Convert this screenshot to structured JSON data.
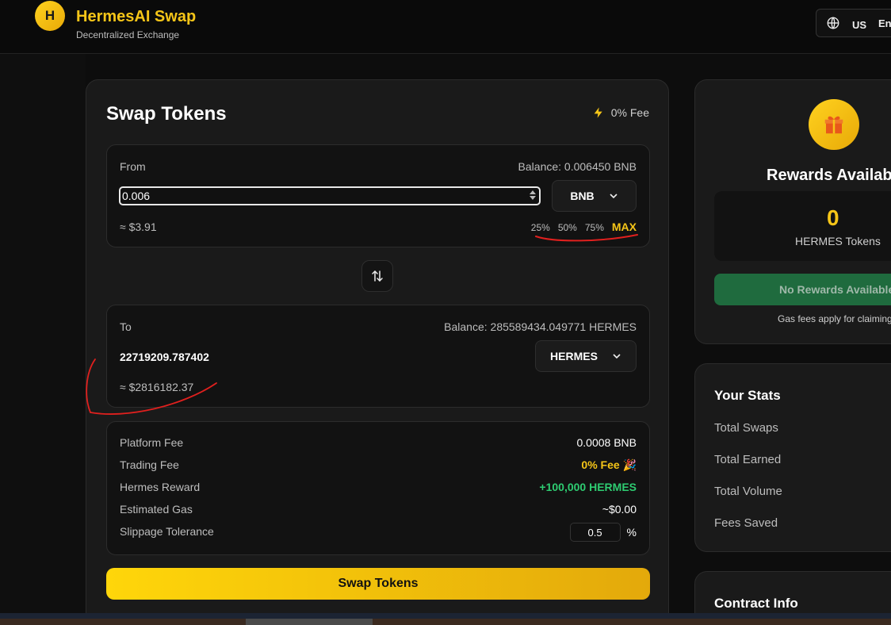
{
  "header": {
    "logo_letter": "H",
    "title": "HermesAI Swap",
    "subtitle": "Decentralized Exchange",
    "region": "US",
    "language": "Eng"
  },
  "swap": {
    "title": "Swap Tokens",
    "fee_tag": "0% Fee",
    "from": {
      "label": "From",
      "balance": "Balance: 0.006450 BNB",
      "amount": "0.006",
      "token": "BNB",
      "usd_estimate": "≈ $3.91",
      "percent_buttons": [
        "25%",
        "50%",
        "75%"
      ],
      "max_label": "MAX"
    },
    "to": {
      "label": "To",
      "balance": "Balance: 285589434.049771 HERMES",
      "amount": "22719209.787402",
      "token": "HERMES",
      "usd_estimate": "≈ $2816182.37"
    },
    "fees": {
      "platform_fee_label": "Platform Fee",
      "platform_fee_value": "0.0008 BNB",
      "trading_fee_label": "Trading Fee",
      "trading_fee_value": "0% Fee 🎉",
      "hermes_reward_label": "Hermes Reward",
      "hermes_reward_value": "+100,000 HERMES",
      "estimated_gas_label": "Estimated Gas",
      "estimated_gas_value": "~$0.00",
      "slippage_label": "Slippage Tolerance",
      "slippage_value": "0.5",
      "slippage_unit": "%"
    },
    "submit_label": "Swap Tokens"
  },
  "rewards": {
    "title": "Rewards Available",
    "amount": "0",
    "unit": "HERMES Tokens",
    "button_label": "No Rewards Available",
    "note": "Gas fees apply for claiming"
  },
  "stats": {
    "title": "Your Stats",
    "items": [
      "Total Swaps",
      "Total Earned",
      "Total Volume",
      "Fees Saved"
    ]
  },
  "contract": {
    "title": "Contract Info"
  },
  "colors": {
    "accent": "#f5c518",
    "green": "#2ecc71",
    "annotation": "#e0201e"
  }
}
